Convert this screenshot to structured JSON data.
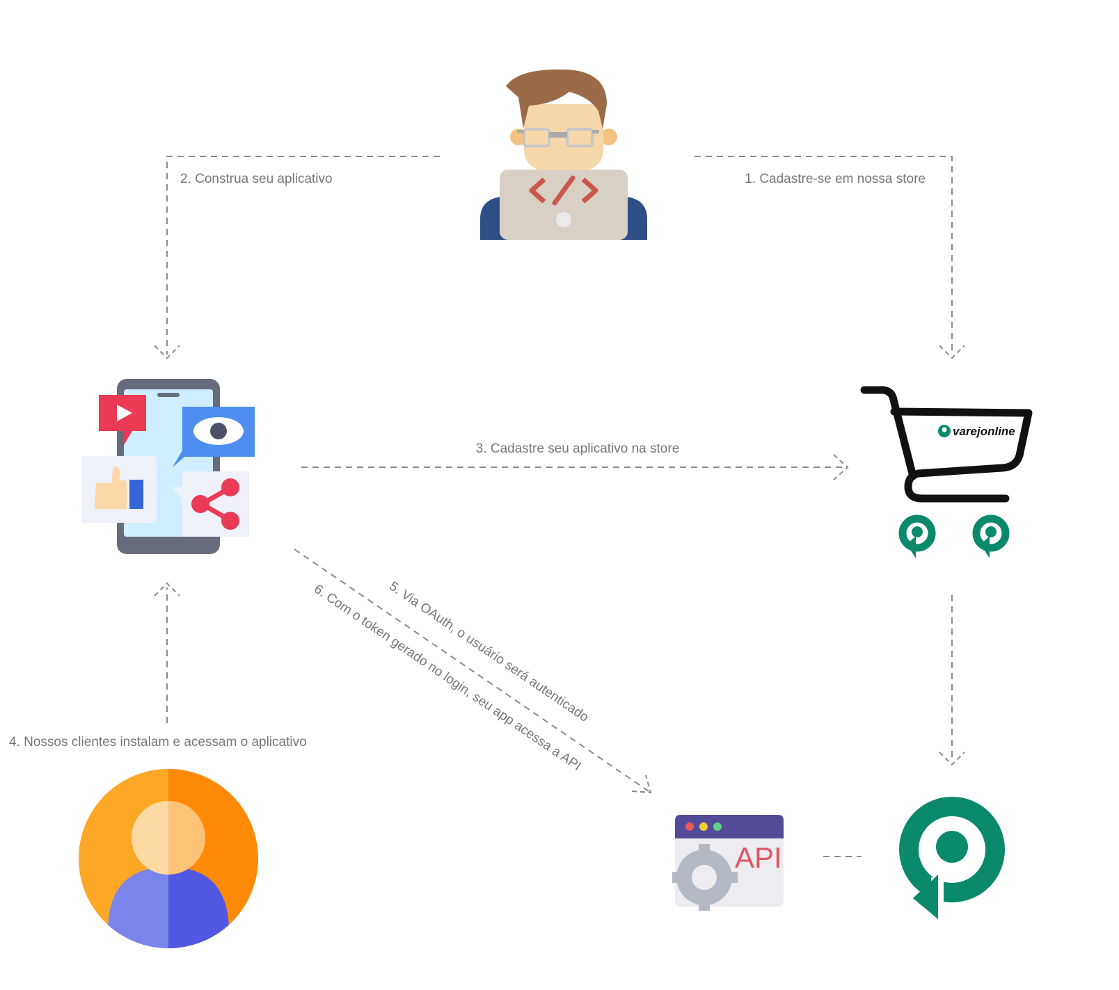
{
  "steps": [
    {
      "id": "step1",
      "label": "1. Cadastre-se em nossa store"
    },
    {
      "id": "step2",
      "label": "2. Construa seu aplicativo"
    },
    {
      "id": "step3",
      "label": "3. Cadastre seu aplicativo na store"
    },
    {
      "id": "step4",
      "label": "4. Nossos clientes instalam e acessam o aplicativo"
    },
    {
      "id": "step5",
      "label": "5. Via OAuth, o usuário será autenticado"
    },
    {
      "id": "step6",
      "label": "6. Com o token gerado no login, seu app acessa a API"
    }
  ],
  "icons": {
    "developer": "developer-icon",
    "mobile_app": "mobile-app-icon",
    "cart": "shopping-cart-icon",
    "customer": "customer-avatar-icon",
    "api": "api-window-icon",
    "platform": "varejonline-logo-icon"
  },
  "cart_logo_text": "varejonline",
  "api_text": "API",
  "colors": {
    "brand_green": "#0a8a6a",
    "line": "#8a8a8a",
    "label": "#777777"
  }
}
